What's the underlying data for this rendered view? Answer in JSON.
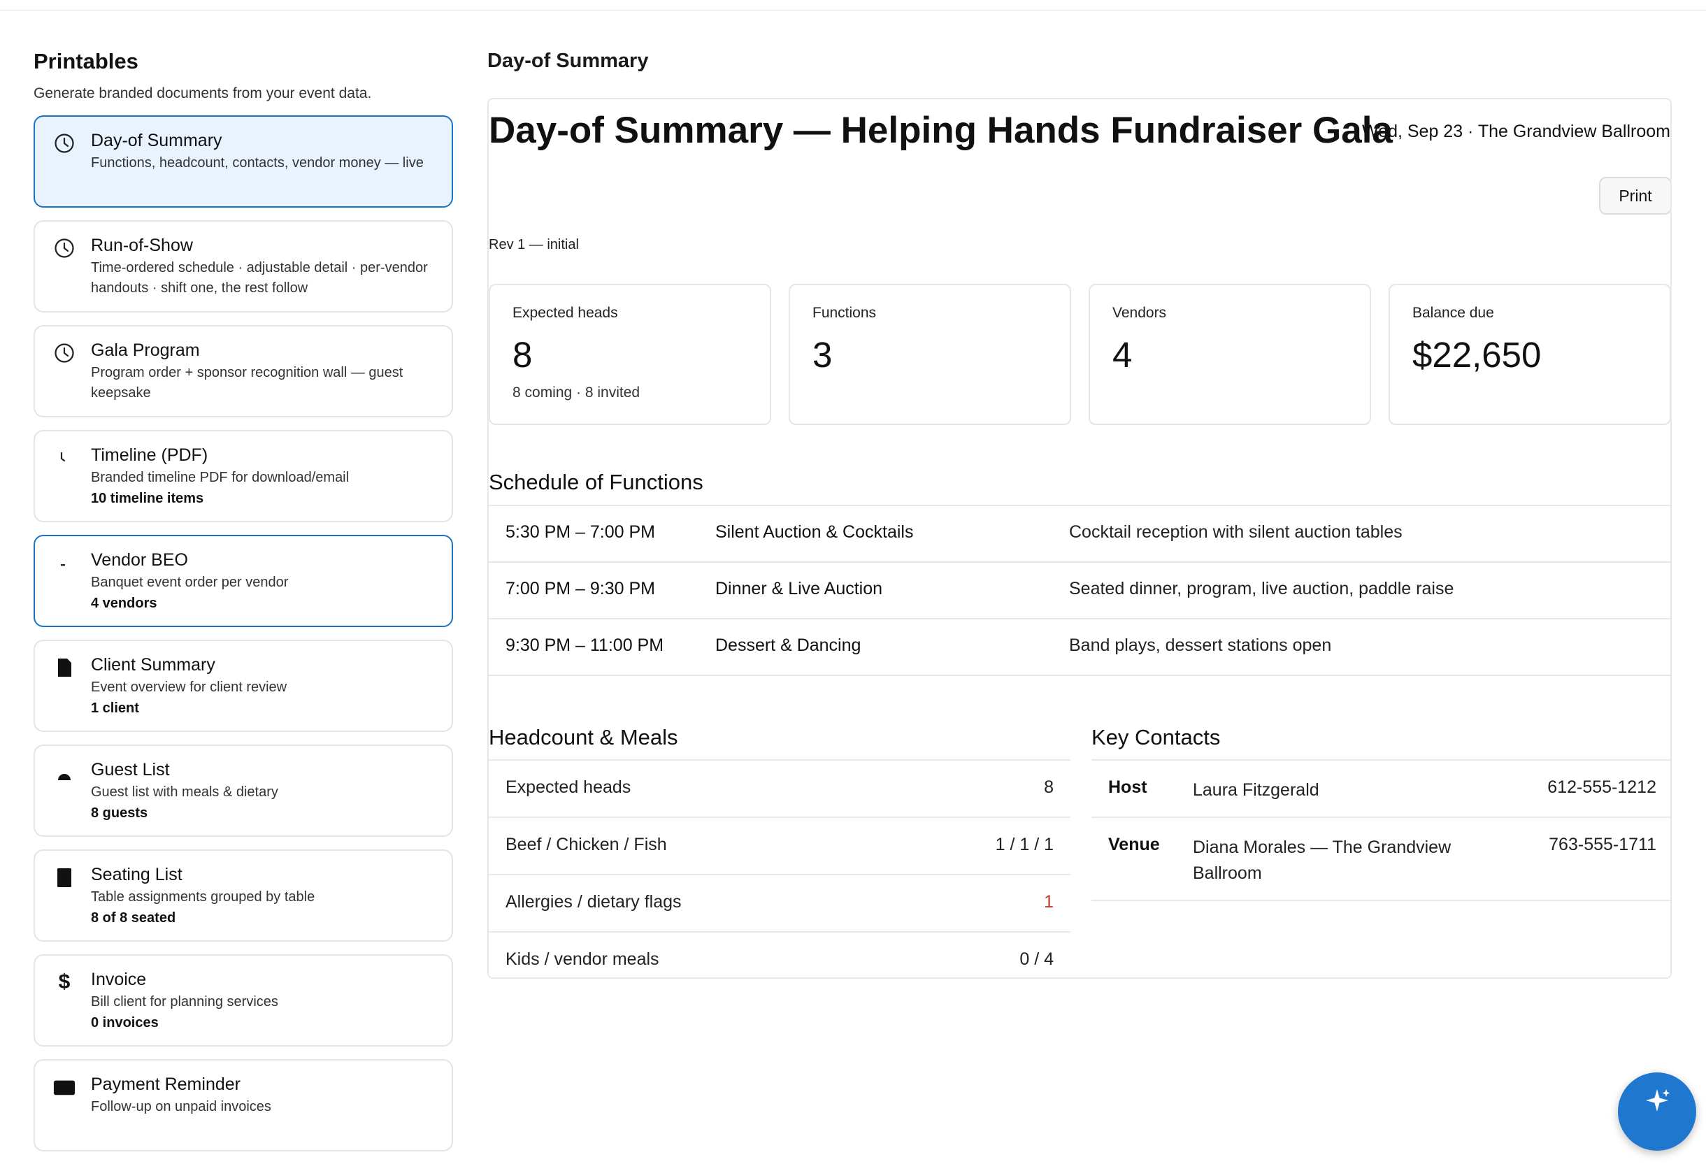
{
  "sidebar": {
    "title": "Printables",
    "subtitle": "Generate branded documents from your event data.",
    "items": [
      {
        "title": "Day-of Summary",
        "desc": "Functions, headcount, contacts, vendor money — live",
        "count": "",
        "icon": "clock-icon",
        "state": "active"
      },
      {
        "title": "Run-of-Show",
        "desc": "Time-ordered schedule · adjustable detail · per-vendor handouts · shift one, the rest follow",
        "count": "",
        "icon": "clock-icon",
        "state": ""
      },
      {
        "title": "Gala Program",
        "desc": "Program order + sponsor recognition wall — guest keepsake",
        "count": "",
        "icon": "clock-icon",
        "state": ""
      },
      {
        "title": "Timeline (PDF)",
        "desc": "Branded timeline PDF for download/email",
        "count": "10 timeline items",
        "icon": "timeline-icon",
        "state": ""
      },
      {
        "title": "Vendor BEO",
        "desc": "Banquet event order per vendor",
        "count": "4 vendors",
        "icon": "beo-icon",
        "state": "outlined"
      },
      {
        "title": "Client Summary",
        "desc": "Event overview for client review",
        "count": "1 client",
        "icon": "document-icon",
        "state": ""
      },
      {
        "title": "Guest List",
        "desc": "Guest list with meals & dietary",
        "count": "8 guests",
        "icon": "guest-icon",
        "state": ""
      },
      {
        "title": "Seating List",
        "desc": "Table assignments grouped by table",
        "count": "8 of 8 seated",
        "icon": "seating-icon",
        "state": ""
      },
      {
        "title": "Invoice",
        "desc": "Bill client for planning services",
        "count": "0 invoices",
        "icon": "dollar-icon",
        "state": ""
      },
      {
        "title": "Payment Reminder",
        "desc": "Follow-up on unpaid invoices",
        "count": "",
        "icon": "payment-icon",
        "state": ""
      }
    ]
  },
  "main": {
    "heading": "Day-of Summary",
    "doc_title": "Day-of Summary — Helping Hands Fundraiser Gala",
    "doc_meta": "Wed, Sep 23 · The Grandview Ballroom",
    "print_label": "Print",
    "revision": "Rev 1 — initial",
    "stats": [
      {
        "label": "Expected heads",
        "value": "8",
        "sub": "8 coming · 8 invited"
      },
      {
        "label": "Functions",
        "value": "3",
        "sub": ""
      },
      {
        "label": "Vendors",
        "value": "4",
        "sub": ""
      },
      {
        "label": "Balance due",
        "value": "$22,650",
        "sub": ""
      }
    ],
    "schedule_title": "Schedule of Functions",
    "schedule": [
      {
        "time": "5:30 PM – 7:00 PM",
        "name": "Silent Auction & Cocktails",
        "desc": "Cocktail reception with silent auction tables"
      },
      {
        "time": "7:00 PM – 9:30 PM",
        "name": "Dinner & Live Auction",
        "desc": "Seated dinner, program, live auction, paddle raise"
      },
      {
        "time": "9:30 PM – 11:00 PM",
        "name": "Dessert & Dancing",
        "desc": "Band plays, dessert stations open"
      }
    ],
    "headcount_title": "Headcount & Meals",
    "headcount": [
      {
        "label": "Expected heads",
        "value": "8"
      },
      {
        "label": "Beef / Chicken / Fish",
        "value": "1 / 1 / 1"
      },
      {
        "label": "Allergies / dietary flags",
        "value": "1"
      },
      {
        "label": "Kids / vendor meals",
        "value": "0 / 4"
      }
    ],
    "contacts_title": "Key Contacts",
    "contacts": [
      {
        "role": "Host",
        "name": "Laura Fitzgerald",
        "phone": "612-555-1212"
      },
      {
        "role": "Venue",
        "name": "Diana Morales — The Grandview Ballroom",
        "phone": "763-555-1711"
      }
    ]
  },
  "colors": {
    "accent": "#1d74c4",
    "active_bg": "#e8f3fd",
    "alert": "#c0392b",
    "fab": "#1f77d0"
  },
  "fab_icon": "sparkle-icon"
}
